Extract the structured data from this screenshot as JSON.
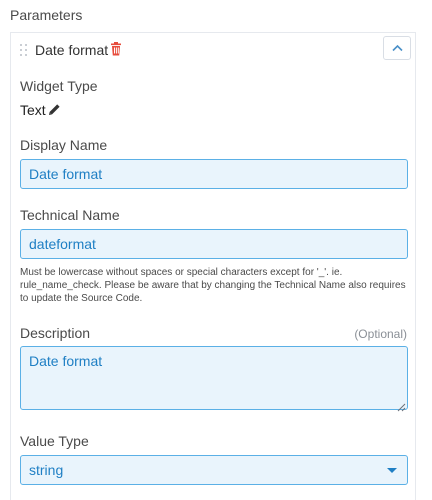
{
  "section": {
    "title": "Parameters"
  },
  "parameter": {
    "title": "Date format",
    "icons": {
      "drag": "drag-handle-icon",
      "delete": "trash-icon",
      "collapse": "chevron-up-icon",
      "edit": "pencil-icon"
    },
    "widget_type": {
      "label": "Widget Type",
      "value": "Text"
    },
    "display_name": {
      "label": "Display Name",
      "value": "Date format"
    },
    "technical_name": {
      "label": "Technical Name",
      "value": "dateformat",
      "help": "Must be lowercase without spaces or special characters except for '_'. ie. rule_name_check. Please be aware that by changing the Technical Name also requires to update the Source Code."
    },
    "description": {
      "label": "Description",
      "optional": "(Optional)",
      "value": "Date format"
    },
    "value_type": {
      "label": "Value Type",
      "selected": "string"
    }
  },
  "colors": {
    "accent": "#1f7fc4",
    "input_border": "#5bb0e6",
    "input_bg": "#e9f4fc",
    "delete": "#e74c3c"
  }
}
